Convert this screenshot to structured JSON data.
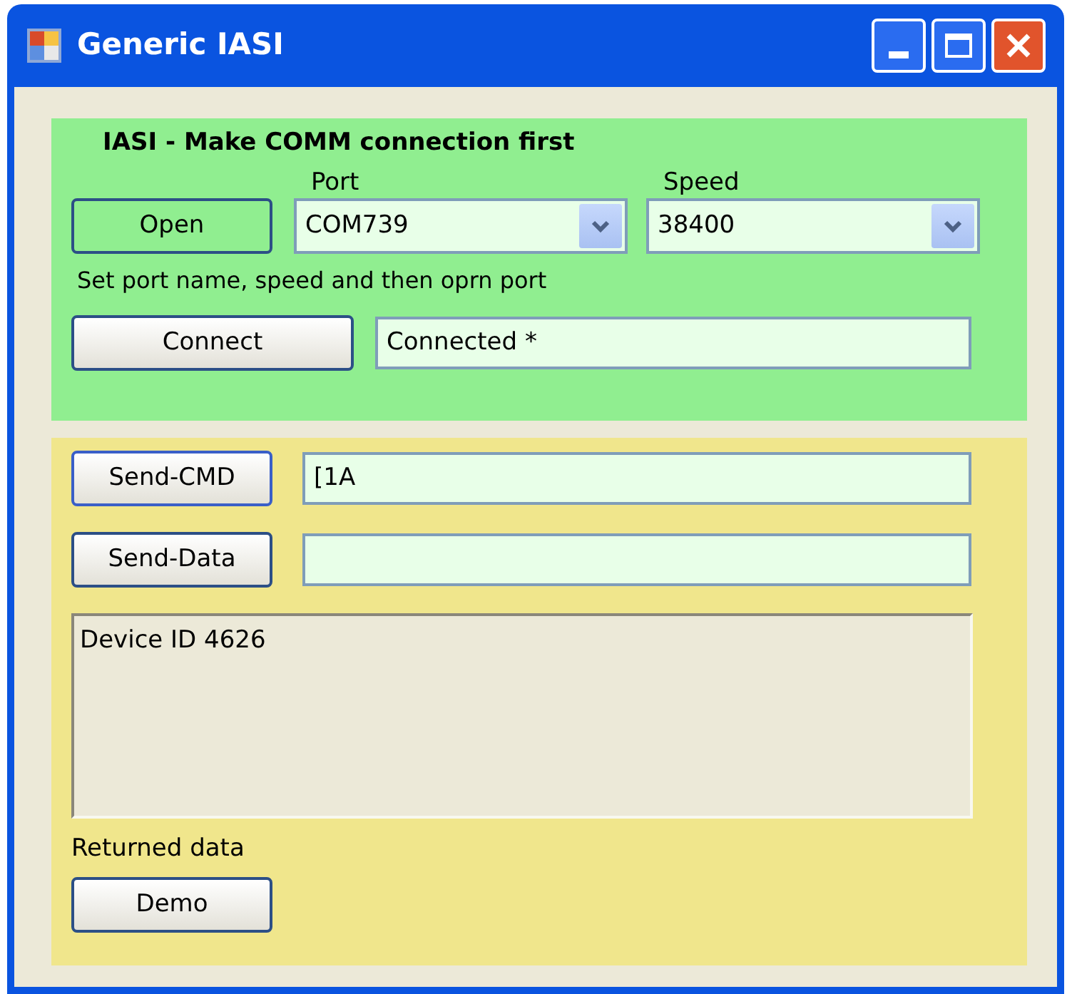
{
  "window": {
    "title": "Generic IASI"
  },
  "connection": {
    "heading": "IASI - Make COMM connection first",
    "open_button": "Open",
    "port": {
      "label": "Port",
      "value": "COM739"
    },
    "speed": {
      "label": "Speed",
      "value": "38400"
    },
    "hint": "Set port name, speed and then oprn port",
    "connect_button": "Connect",
    "status": "Connected *"
  },
  "commands": {
    "send_cmd_button": "Send-CMD",
    "command_value": "[1A",
    "send_data_button": "Send-Data",
    "output": "Device ID 4626",
    "output_label": "Returned data",
    "demo_button": "Demo"
  }
}
